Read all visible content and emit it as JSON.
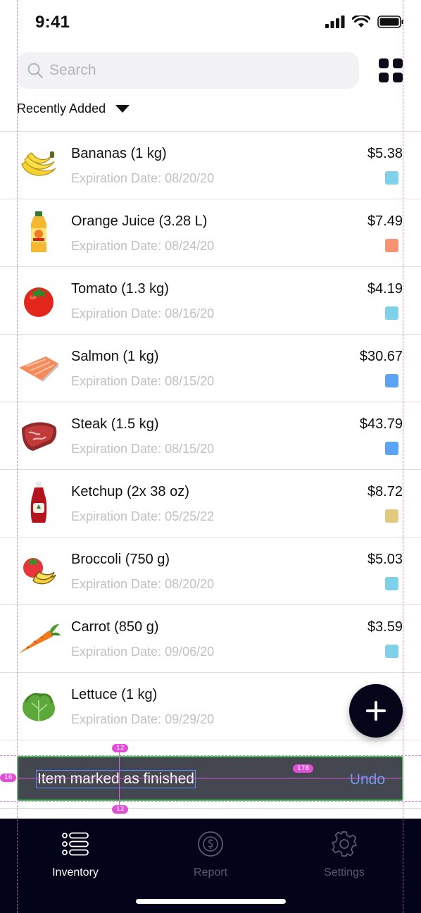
{
  "status": {
    "time": "9:41"
  },
  "search": {
    "placeholder": "Search"
  },
  "sort": {
    "label": "Recently Added"
  },
  "items": [
    {
      "name": "Bananas (1 kg)",
      "expiration": "Expiration Date: 08/20/20",
      "price": "$5.38",
      "tag_color": "#7fd1ea",
      "icon": "banana-icon"
    },
    {
      "name": "Orange Juice (3.28 L)",
      "expiration": "Expiration Date: 08/24/20",
      "price": "$7.49",
      "tag_color": "#f79373",
      "icon": "orange-juice-icon"
    },
    {
      "name": "Tomato (1.3 kg)",
      "expiration": "Expiration Date: 08/16/20",
      "price": "$4.19",
      "tag_color": "#7fd1ea",
      "icon": "tomato-icon"
    },
    {
      "name": "Salmon (1 kg)",
      "expiration": "Expiration Date: 08/15/20",
      "price": "$30.67",
      "tag_color": "#5ba4f5",
      "icon": "salmon-icon"
    },
    {
      "name": "Steak (1.5 kg)",
      "expiration": "Expiration Date: 08/15/20",
      "price": "$43.79",
      "tag_color": "#5ba4f5",
      "icon": "steak-icon"
    },
    {
      "name": "Ketchup (2x 38 oz)",
      "expiration": "Expiration Date: 05/25/22",
      "price": "$8.72",
      "tag_color": "#e0ca7e",
      "icon": "ketchup-icon"
    },
    {
      "name": "Broccoli (750 g)",
      "expiration": "Expiration Date: 08/20/20",
      "price": "$5.03",
      "tag_color": "#7fd1ea",
      "icon": "mixed-produce-icon"
    },
    {
      "name": "Carrot (850 g)",
      "expiration": "Expiration Date: 09/06/20",
      "price": "$3.59",
      "tag_color": "#7fd1ea",
      "icon": "carrot-icon"
    },
    {
      "name": "Lettuce (1 kg)",
      "expiration": "Expiration Date: 09/29/20",
      "price": "",
      "tag_color": "",
      "icon": "lettuce-icon"
    }
  ],
  "snackbar": {
    "message": "Item marked as finished",
    "action": "Undo"
  },
  "tabs": [
    {
      "label": "Inventory",
      "icon": "list-icon",
      "active": true
    },
    {
      "label": "Report",
      "icon": "dollar-circle-icon",
      "active": false
    },
    {
      "label": "Settings",
      "icon": "gear-icon",
      "active": false
    }
  ],
  "overlay": {
    "spacing_top": "12",
    "spacing_bottom": "12",
    "spacing_left": "16",
    "spacing_right": "178"
  },
  "colors": {
    "accent": "#6d9af7",
    "tab_bar": "#03031a",
    "snackbar_bg": "#44474f",
    "snackbar_border": "#3bcc52"
  }
}
